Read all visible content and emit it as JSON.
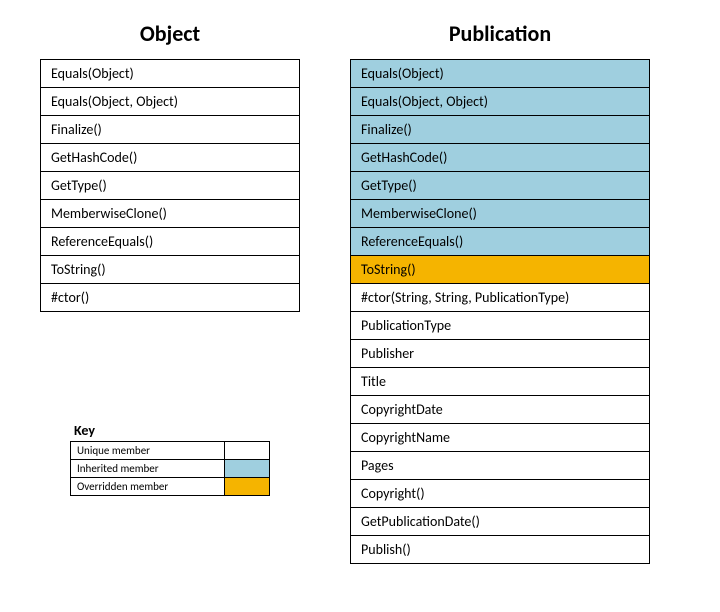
{
  "object_title": "Object",
  "publication_title": "Publication",
  "object_members": [
    {
      "label": "Equals(Object)",
      "kind": "unique"
    },
    {
      "label": "Equals(Object, Object)",
      "kind": "unique"
    },
    {
      "label": "Finalize()",
      "kind": "unique"
    },
    {
      "label": "GetHashCode()",
      "kind": "unique"
    },
    {
      "label": "GetType()",
      "kind": "unique"
    },
    {
      "label": "MemberwiseClone()",
      "kind": "unique"
    },
    {
      "label": "ReferenceEquals()",
      "kind": "unique"
    },
    {
      "label": "ToString()",
      "kind": "unique"
    },
    {
      "label": "#ctor()",
      "kind": "unique"
    }
  ],
  "publication_members": [
    {
      "label": "Equals(Object)",
      "kind": "inherited"
    },
    {
      "label": "Equals(Object, Object)",
      "kind": "inherited"
    },
    {
      "label": "Finalize()",
      "kind": "inherited"
    },
    {
      "label": "GetHashCode()",
      "kind": "inherited"
    },
    {
      "label": "GetType()",
      "kind": "inherited"
    },
    {
      "label": "MemberwiseClone()",
      "kind": "inherited"
    },
    {
      "label": "ReferenceEquals()",
      "kind": "inherited"
    },
    {
      "label": "ToString()",
      "kind": "overridden"
    },
    {
      "label": "#ctor(String, String, PublicationType)",
      "kind": "unique"
    },
    {
      "label": "PublicationType",
      "kind": "unique"
    },
    {
      "label": "Publisher",
      "kind": "unique"
    },
    {
      "label": "Title",
      "kind": "unique"
    },
    {
      "label": "CopyrightDate",
      "kind": "unique"
    },
    {
      "label": "CopyrightName",
      "kind": "unique"
    },
    {
      "label": "Pages",
      "kind": "unique"
    },
    {
      "label": "Copyright()",
      "kind": "unique"
    },
    {
      "label": "GetPublicationDate()",
      "kind": "unique"
    },
    {
      "label": "Publish()",
      "kind": "unique"
    }
  ],
  "key": {
    "title": "Key",
    "rows": [
      {
        "label": "Unique member",
        "kind": "unique"
      },
      {
        "label": "Inherited member",
        "kind": "inherited"
      },
      {
        "label": "Overridden member",
        "kind": "overridden"
      }
    ]
  },
  "colors": {
    "inherited": "#9fcfdf",
    "overridden": "#f5b400",
    "unique": "#ffffff"
  }
}
